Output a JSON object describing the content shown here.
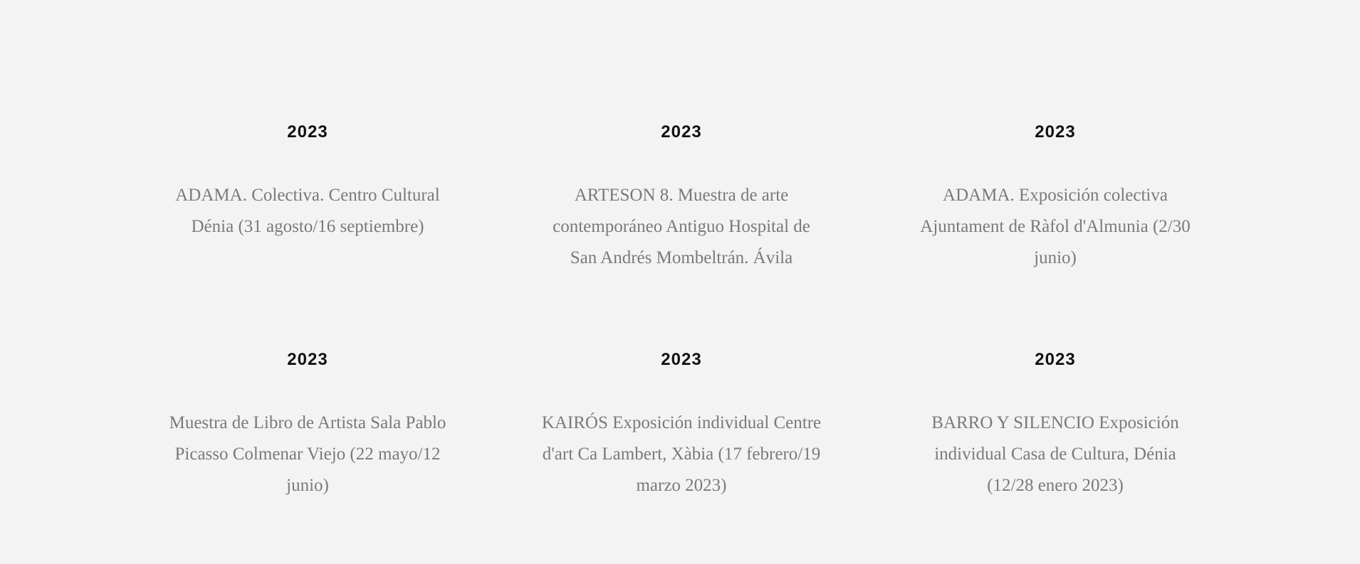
{
  "exhibitions": [
    {
      "year": "2023",
      "description": "ADAMA. Colectiva. Centro Cultural Dénia (31 agosto/16 septiembre)"
    },
    {
      "year": "2023",
      "description": "ARTESON 8. Muestra de arte contemporáneo Antiguo Hospital de San Andrés Mombeltrán. Ávila"
    },
    {
      "year": "2023",
      "description": "ADAMA. Exposición colectiva Ajuntament de Ràfol d'Almunia (2/30 junio)"
    },
    {
      "year": "2023",
      "description": "Muestra de Libro de Artista Sala Pablo Picasso Colmenar Viejo (22 mayo/12 junio)"
    },
    {
      "year": "2023",
      "description": "KAIRÓS Exposición individual Centre d'art Ca Lambert, Xàbia (17 febrero/19 marzo 2023)"
    },
    {
      "year": "2023",
      "description": "BARRO Y SILENCIO Exposición individual Casa de Cultura, Dénia (12/28 enero 2023)"
    }
  ]
}
